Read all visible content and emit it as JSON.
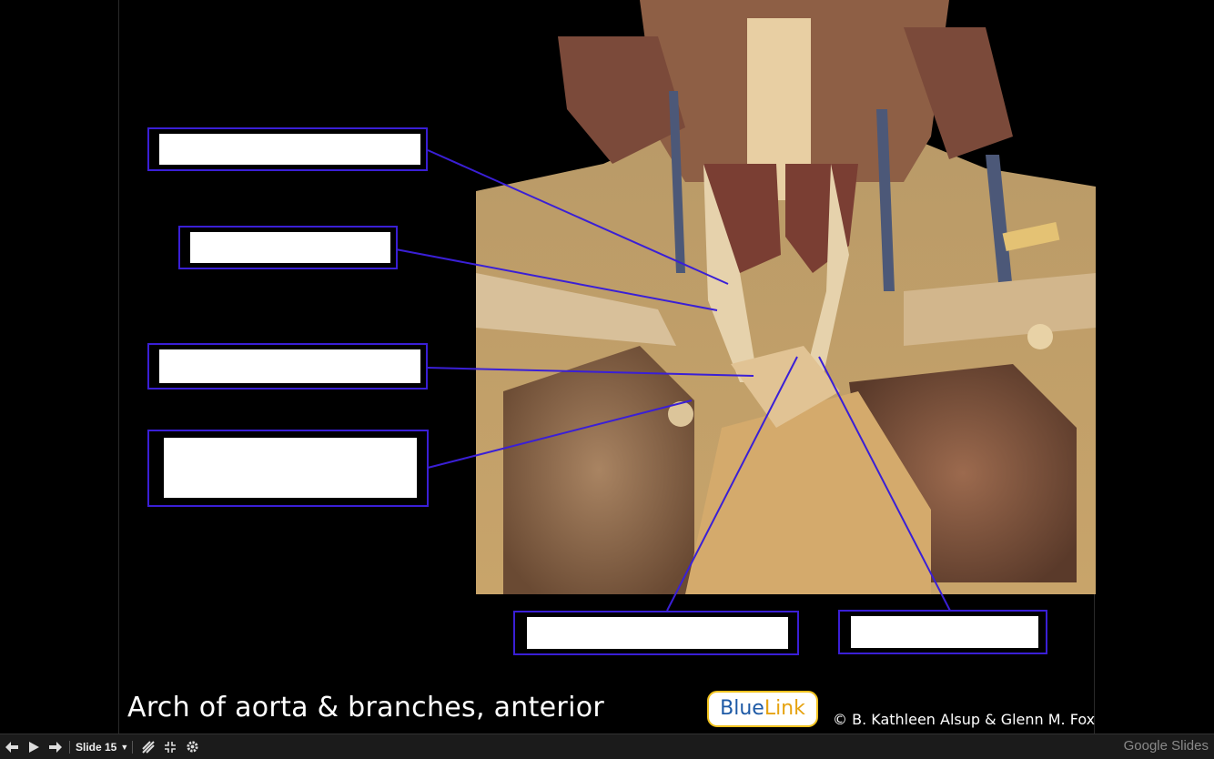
{
  "slide": {
    "title": "Arch of aorta & branches, anterior",
    "logo": {
      "part1": "Blue",
      "part2": "Link"
    },
    "copyright": "© B. Kathleen Alsup & Glenn M. Fox",
    "label_boxes": [
      {
        "id": "label-1",
        "text": ""
      },
      {
        "id": "label-2",
        "text": ""
      },
      {
        "id": "label-3",
        "text": ""
      },
      {
        "id": "label-4",
        "text": ""
      },
      {
        "id": "label-5",
        "text": ""
      },
      {
        "id": "label-6",
        "text": ""
      }
    ]
  },
  "presenter_bar": {
    "slide_label": "Slide 15",
    "icons": [
      "prev-arrow-icon",
      "play-icon",
      "next-arrow-icon",
      "chevron-down-icon",
      "laser-pointer-icon",
      "exit-fullscreen-icon",
      "gear-icon"
    ],
    "brand": {
      "part1": "Google",
      "part2": " Slides"
    }
  },
  "colors": {
    "label_border": "#3a1fd6",
    "leader_line": "#3a1fd6",
    "background": "#000000",
    "bar": "#1b1b1b"
  }
}
